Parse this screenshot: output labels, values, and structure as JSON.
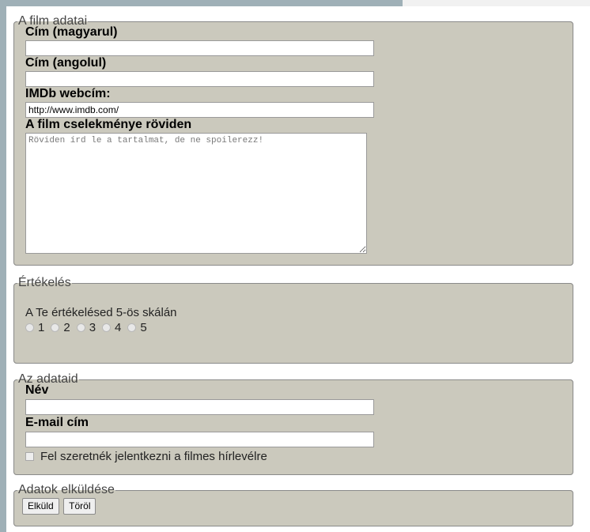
{
  "film": {
    "legend": "A film adatai",
    "title_hu_label": "Cím (magyarul)",
    "title_hu_value": "",
    "title_en_label": "Cím (angolul)",
    "title_en_value": "",
    "imdb_label": "IMDb webcím:",
    "imdb_value": "http://www.imdb.com/",
    "plot_label": "A film cselekménye röviden",
    "plot_placeholder": "Röviden írd le a tartalmat, de ne spoilerezz!"
  },
  "rating": {
    "legend": "Értékelés",
    "prompt": "A Te értékelésed 5-ös skálán",
    "options": [
      "1",
      "2",
      "3",
      "4",
      "5"
    ]
  },
  "user": {
    "legend": "Az adataid",
    "name_label": "Név",
    "name_value": "",
    "email_label": "E-mail cím",
    "email_value": "",
    "newsletter_label": "Fel szeretnék jelentkezni a filmes hírlevélre"
  },
  "submit": {
    "legend": "Adatok elküldése",
    "send_label": "Elküld",
    "reset_label": "Töröl"
  }
}
